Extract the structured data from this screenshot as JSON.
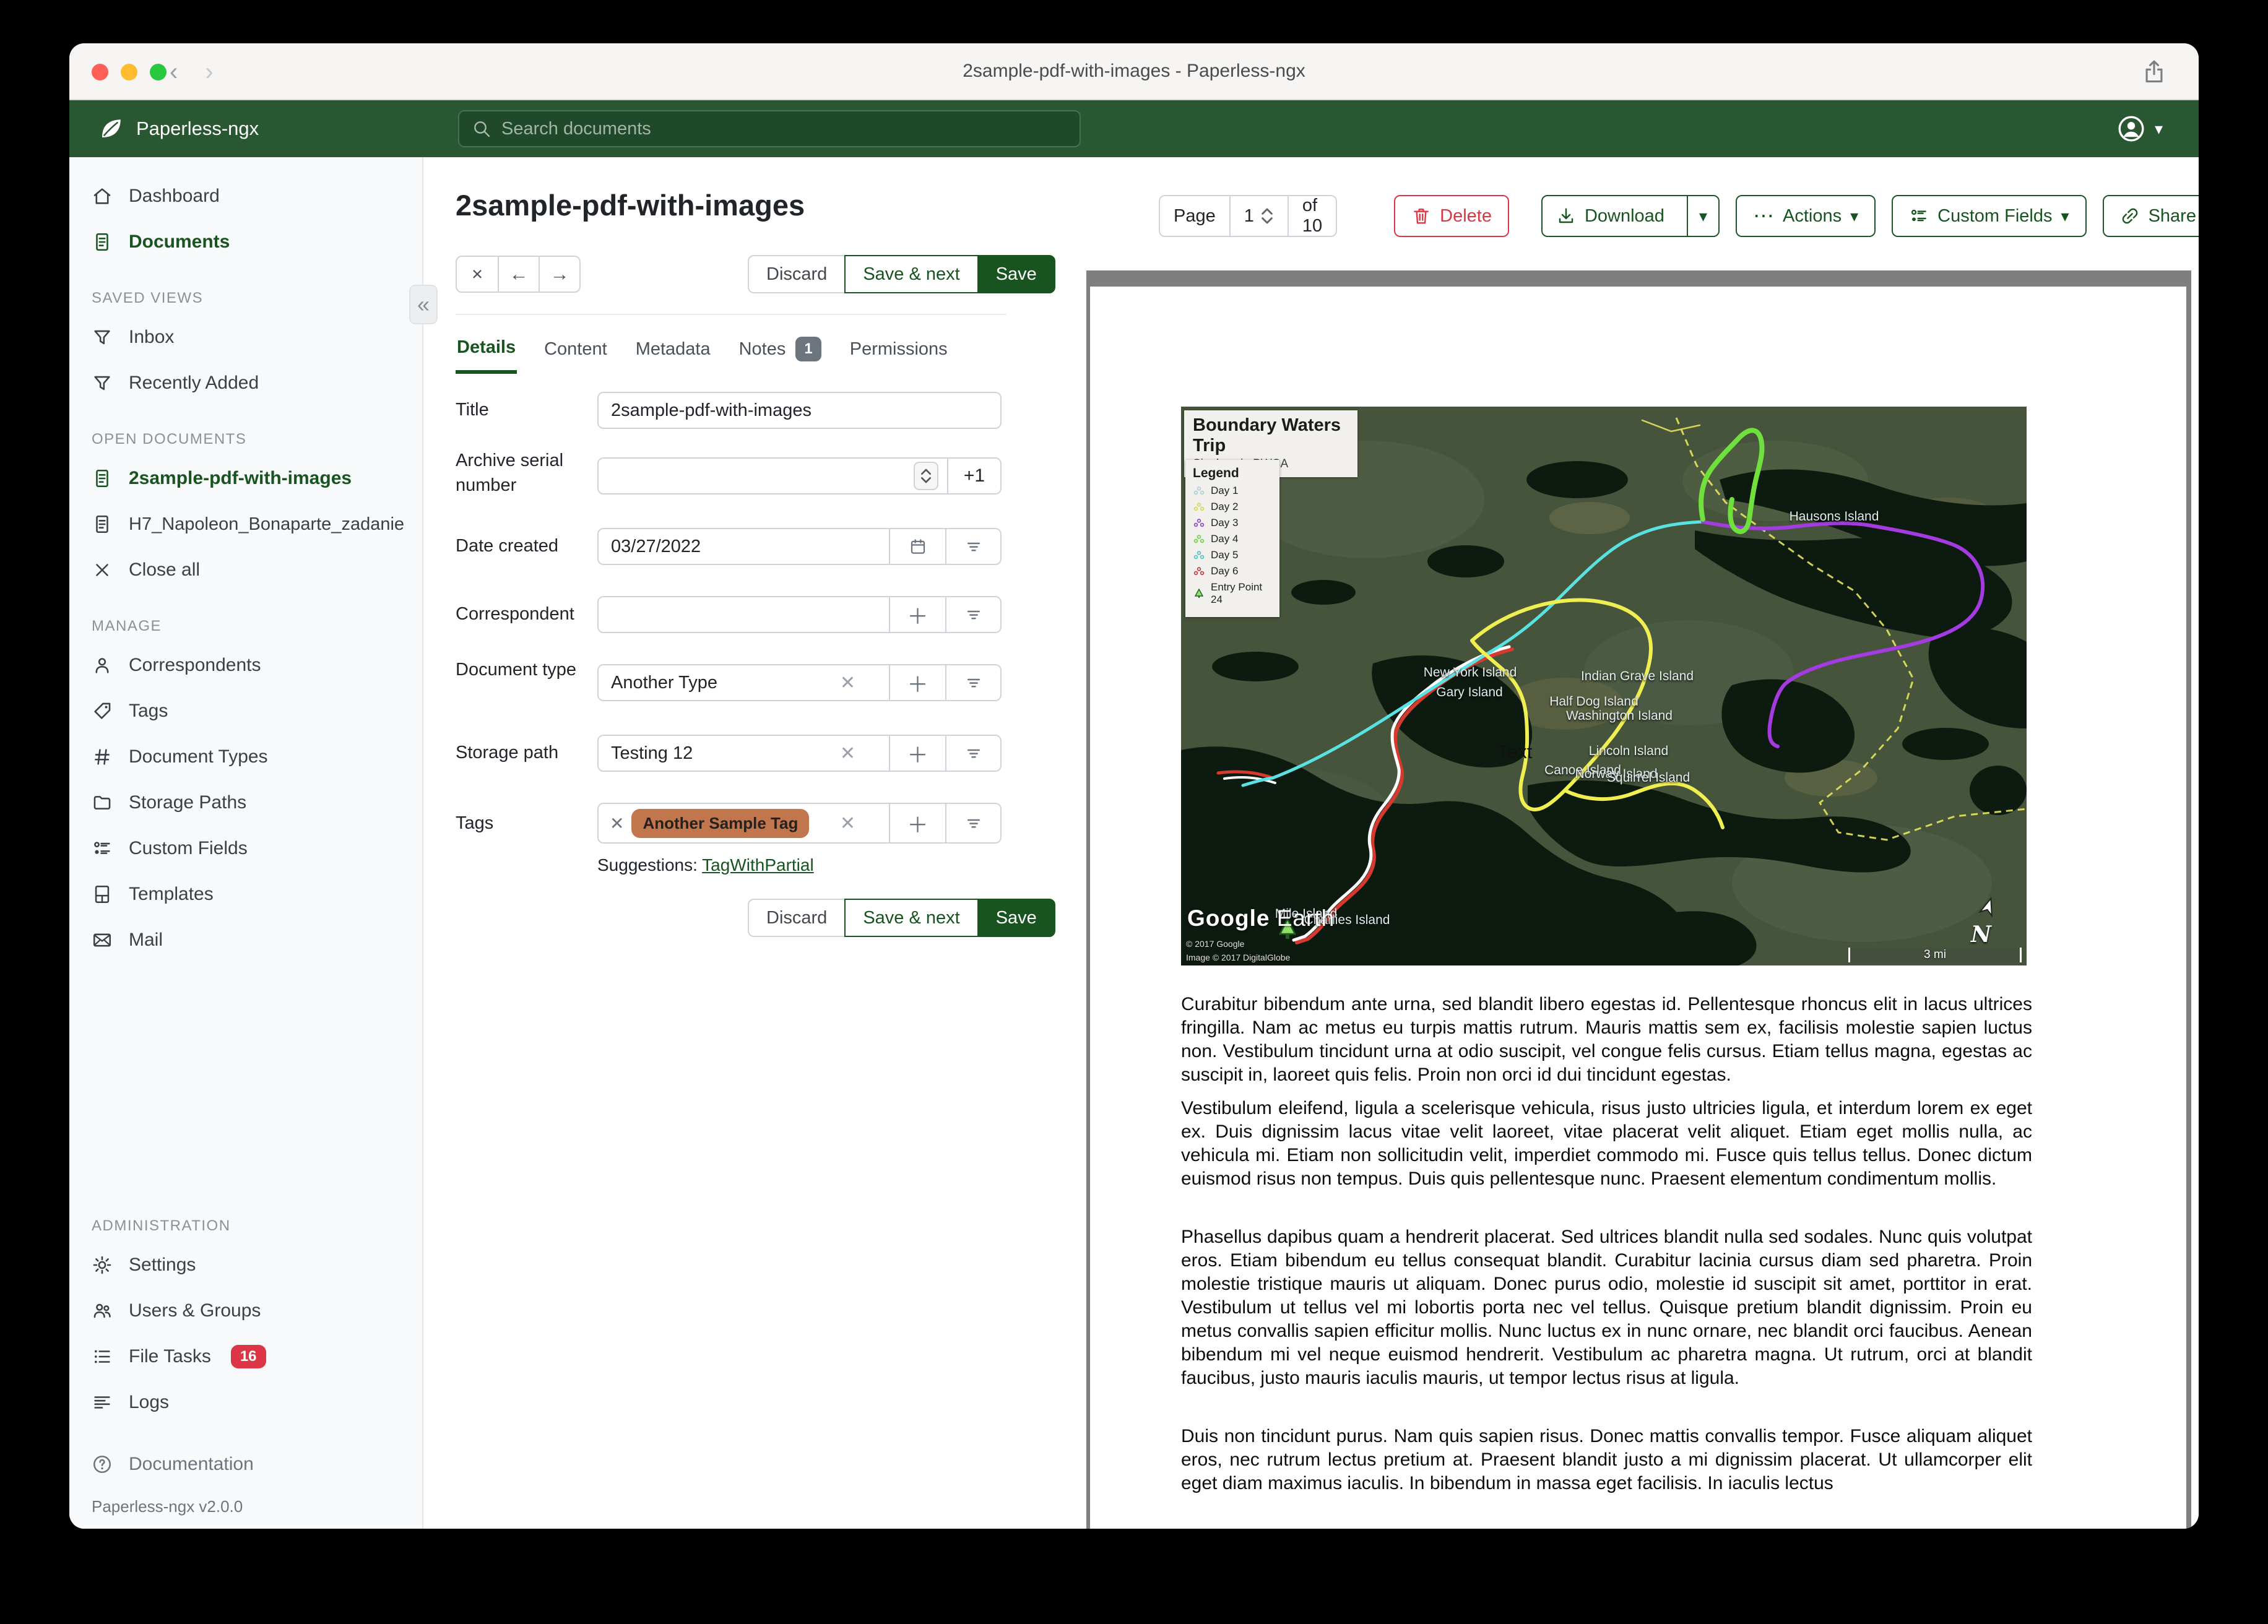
{
  "window": {
    "titlebar_title": "2sample-pdf-with-images - Paperless-ngx"
  },
  "icons": {
    "close": "×",
    "prev": "←",
    "next": "→",
    "collapse": "«",
    "caret": "▾",
    "ellipsis": "⋯"
  },
  "appbar": {
    "brand": "Paperless-ngx",
    "search_placeholder": "Search documents"
  },
  "sidebar": {
    "nav": [
      {
        "label": "Dashboard"
      },
      {
        "label": "Documents"
      }
    ],
    "saved_views_label": "SAVED VIEWS",
    "saved_views": [
      {
        "label": "Inbox"
      },
      {
        "label": "Recently Added"
      }
    ],
    "open_documents_label": "OPEN DOCUMENTS",
    "open_docs": [
      {
        "label": "2sample-pdf-with-images"
      },
      {
        "label": "H7_Napoleon_Bonaparte_zadanie"
      }
    ],
    "close_all": "Close all",
    "manage_label": "MANAGE",
    "manage": [
      {
        "label": "Correspondents"
      },
      {
        "label": "Tags"
      },
      {
        "label": "Document Types"
      },
      {
        "label": "Storage Paths"
      },
      {
        "label": "Custom Fields"
      },
      {
        "label": "Templates"
      },
      {
        "label": "Mail"
      }
    ],
    "admin_label": "ADMINISTRATION",
    "admin": [
      {
        "label": "Settings"
      },
      {
        "label": "Users & Groups"
      },
      {
        "label": "File Tasks",
        "badge": "16"
      },
      {
        "label": "Logs"
      }
    ],
    "documentation": "Documentation",
    "version": "Paperless-ngx v2.0.0"
  },
  "doc": {
    "title": "2sample-pdf-with-images"
  },
  "toolbar": {
    "page_label": "Page",
    "page_value": "1",
    "of_label": "of 10",
    "delete": "Delete",
    "download": "Download",
    "actions": "Actions",
    "custom_fields": "Custom Fields",
    "share_links": "Share Links"
  },
  "edit_actions": {
    "discard": "Discard",
    "save_next": "Save & next",
    "save": "Save"
  },
  "tabs": [
    {
      "label": "Details"
    },
    {
      "label": "Content"
    },
    {
      "label": "Metadata"
    },
    {
      "label": "Notes",
      "badge": "1"
    },
    {
      "label": "Permissions"
    }
  ],
  "form": {
    "title_label": "Title",
    "title_value": "2sample-pdf-with-images",
    "asn_label": "Archive serial number",
    "asn_value": "",
    "asn_plus": "+1",
    "date_label": "Date created",
    "date_value": "03/27/2022",
    "correspondent_label": "Correspondent",
    "doctype_label": "Document type",
    "doctype_value": "Another Type",
    "storage_label": "Storage path",
    "storage_value": "Testing 12",
    "tags_label": "Tags",
    "tag_chip": "Another Sample Tag",
    "tag_color": "#c1764d",
    "suggestions_label": "Suggestions:",
    "suggestion_link": "TagWithPartial"
  },
  "preview": {
    "map": {
      "title": "Boundary Waters Trip",
      "subtitle": "Six days in BWCA",
      "legend_title": "Legend",
      "legend_items": [
        {
          "label": "Day 1",
          "color": "#a8ccd2"
        },
        {
          "label": "Day 2",
          "color": "#d6d64a"
        },
        {
          "label": "Day 3",
          "color": "#8a3fd6"
        },
        {
          "label": "Day 4",
          "color": "#66d23e"
        },
        {
          "label": "Day 5",
          "color": "#3fc6c6"
        },
        {
          "label": "Day 6",
          "color": "#c43434"
        },
        {
          "label": "Entry Point 24",
          "color": "#4f9e3c"
        }
      ],
      "islands": [
        {
          "label": "New York Island"
        },
        {
          "label": "Gary Island"
        },
        {
          "label": "Hausons Island"
        },
        {
          "label": "Indian Grave Island"
        },
        {
          "label": "Half Dog Island"
        },
        {
          "label": "Washington Island"
        },
        {
          "label": "Lincoln Island"
        },
        {
          "label": "Canoe Island"
        },
        {
          "label": "Norway Island"
        },
        {
          "label": "Squirrel Island"
        },
        {
          "label": "Mile Island"
        },
        {
          "label": "Charlies Island"
        }
      ],
      "text_label": "Text",
      "attribution_logo": "Google Earth",
      "attribution_1": "© 2017 Google",
      "attribution_2": "Image © 2017 DigitalGlobe",
      "scale_label": "3 mi",
      "north_label": "N"
    },
    "paragraphs": [
      "Curabitur bibendum ante urna, sed blandit libero egestas id. Pellentesque rhoncus elit in lacus ultrices fringilla. Nam ac metus eu turpis mattis rutrum. Mauris mattis sem ex, facilisis molestie sapien luctus non. Vestibulum tincidunt urna at odio suscipit, vel congue felis cursus. Etiam tellus magna, egestas ac suscipit in, laoreet quis felis. Proin non orci id dui tincidunt egestas.",
      "Vestibulum eleifend, ligula a scelerisque vehicula, risus justo ultricies ligula, et interdum lorem ex eget ex. Duis dignissim lacus vitae velit laoreet, vitae placerat velit aliquet. Etiam eget mollis nulla, ac vehicula mi. Etiam non sollicitudin velit, imperdiet commodo mi. Fusce quis tellus tellus. Donec dictum euismod risus non tempus. Duis quis pellentesque nunc. Praesent elementum condimentum mollis.",
      "Phasellus dapibus quam a hendrerit placerat. Sed ultrices blandit nulla sed sodales. Nunc quis volutpat eros. Etiam bibendum eu tellus consequat blandit. Curabitur lacinia cursus diam sed pharetra. Proin molestie tristique mauris ut aliquam. Donec purus odio, molestie id suscipit sit amet, porttitor in erat. Vestibulum ut tellus vel mi lobortis porta nec vel tellus. Quisque pretium blandit dignissim. Proin eu metus convallis sapien efficitur mollis. Nunc luctus ex in nunc ornare, nec blandit orci faucibus. Aenean bibendum mi vel neque euismod hendrerit. Vestibulum ac pharetra magna. Ut rutrum, orci at blandit faucibus, justo mauris iaculis mauris, ut tempor lectus risus at ligula.",
      "Duis non tincidunt purus. Nam quis sapien risus. Donec mattis convallis tempor. Fusce aliquam aliquet eros, nec rutrum lectus pretium at. Praesent blandit justo a mi dignissim placerat. Ut ullamcorper elit eget diam maximus iaculis. In bibendum in massa eget facilisis. In iaculis lectus"
    ]
  }
}
